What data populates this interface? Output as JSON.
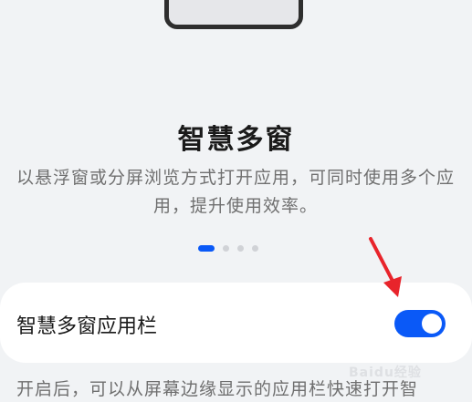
{
  "feature": {
    "title": "智慧多窗",
    "description": "以悬浮窗或分屏浏览方式打开应用，可同时使用多个应用，提升使用效率。"
  },
  "pager": {
    "total": 4,
    "active_index": 0
  },
  "setting": {
    "label": "智慧多窗应用栏",
    "enabled": true
  },
  "footer": {
    "text": "开启后，可以从屏幕边缘显示的应用栏快速打开智"
  },
  "watermark": {
    "text": "Baidu经验"
  },
  "colors": {
    "accent": "#0a59f7",
    "annotation_arrow": "#e8242b",
    "background": "#f1f3f5"
  }
}
